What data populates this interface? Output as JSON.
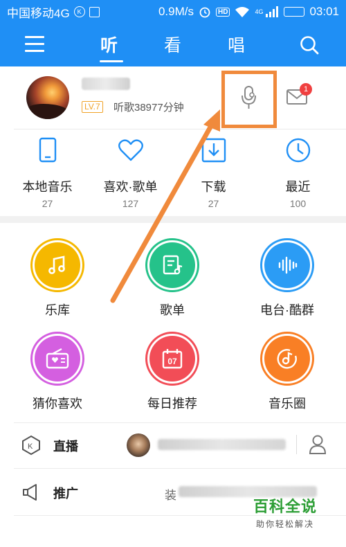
{
  "status_bar": {
    "carrier": "中国移动4G",
    "speed": "0.9M/s",
    "hd_badge": "HD",
    "network": "4G",
    "time": "03:01"
  },
  "nav": {
    "tabs": [
      "听",
      "看",
      "唱"
    ],
    "active_tab": "听",
    "accent_color": "#1f8ff5"
  },
  "profile": {
    "level": "LV.7",
    "listen_time": "听歌38977分钟",
    "mail_badge": "1"
  },
  "quick_access": [
    {
      "label": "本地音乐",
      "count": "27",
      "icon": "phone-icon"
    },
    {
      "label": "喜欢·歌单",
      "count": "127",
      "icon": "heart-icon"
    },
    {
      "label": "下载",
      "count": "27",
      "icon": "download-icon"
    },
    {
      "label": "最近",
      "count": "100",
      "icon": "clock-icon"
    }
  ],
  "features": [
    {
      "label": "乐库",
      "color": "#f5b800",
      "icon": "music-note-icon"
    },
    {
      "label": "歌单",
      "color": "#25c28a",
      "icon": "playlist-icon"
    },
    {
      "label": "电台·酷群",
      "color": "#2b9cf5",
      "icon": "soundwave-icon"
    },
    {
      "label": "猜你喜欢",
      "color": "#d45fe0",
      "icon": "radio-icon"
    },
    {
      "label": "每日推荐",
      "color": "#f24d57",
      "icon": "calendar-icon"
    },
    {
      "label": "音乐圈",
      "color": "#f97f25",
      "icon": "music-circle-icon"
    }
  ],
  "calendar_day": "07",
  "rows": [
    {
      "label": "直播",
      "icon": "live-icon"
    },
    {
      "label": "推广",
      "icon": "megaphone-icon",
      "text": "装"
    }
  ],
  "watermark": {
    "logo": "百科全说",
    "sub": "助你轻松解决"
  },
  "highlight_color": "#f08a3c"
}
